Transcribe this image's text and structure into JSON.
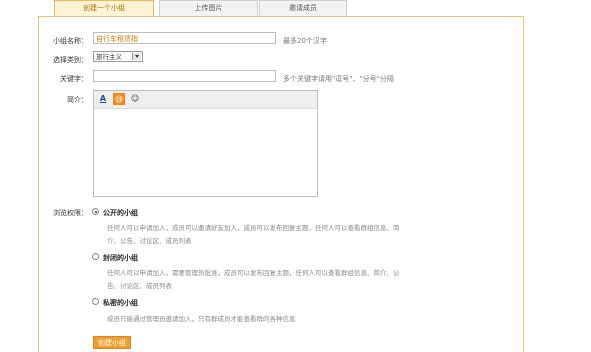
{
  "tabs": [
    {
      "label": "创建一个小组",
      "active": true
    },
    {
      "label": "上传图片",
      "active": false
    },
    {
      "label": "邀请成员",
      "active": false
    }
  ],
  "form": {
    "name_label": "小组名称：",
    "name_value": "自行车租赁指",
    "name_hint": "最多20个汉字",
    "category_label": "选择类别：",
    "category_value": "旅行主义",
    "keywords_label": "关键字：",
    "keywords_value": "",
    "keywords_hint": "多个关键字请用\"逗号\"、\"分号\"分隔",
    "intro_label": "简介：",
    "editor_buttons": [
      {
        "icon": "font-color-icon",
        "glyph": "A"
      },
      {
        "icon": "at-icon",
        "glyph": "@"
      },
      {
        "icon": "emoticon-icon",
        "glyph": "☺"
      }
    ],
    "privacy_label": "浏览权限：",
    "options": [
      {
        "label": "公开的小组",
        "checked": true,
        "desc": "任何人可以申请加入，成员可以邀请好友加入，成员可以发布回复主题，任何人可以查看群组信息、简介、公告、讨论区、成员列表"
      },
      {
        "label": "封闭的小组",
        "checked": false,
        "desc": "任何人可以申请加入，需要管理员批准，成员可以发布回复主题，任何人可以查看群组信息、简介、公告、讨论区、成员列表"
      },
      {
        "label": "私密的小组",
        "checked": false,
        "desc": "成员只能通过管理员邀请加入，只有群成员才能查看群的各种信息"
      }
    ],
    "submit_label": "创建小组"
  },
  "colors": {
    "accent": "#f0a030",
    "tab_border": "#e8b95a",
    "panel_border": "#f0c07a"
  }
}
